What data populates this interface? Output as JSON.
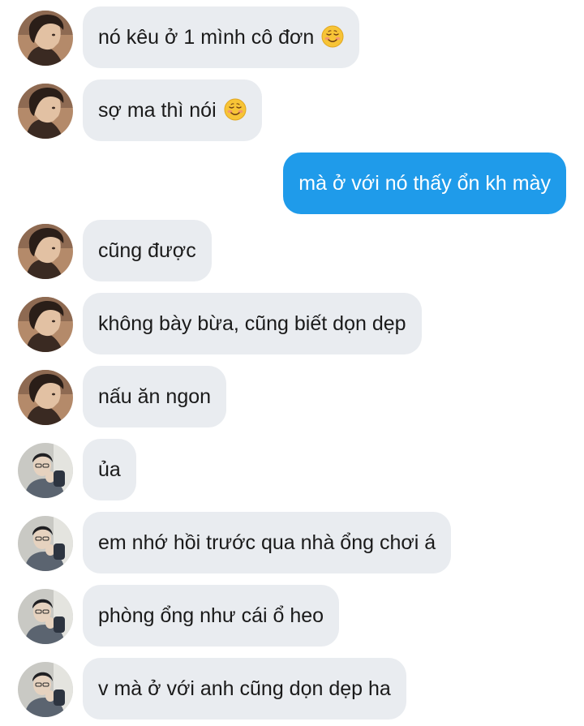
{
  "colors": {
    "incoming_bubble": "#e9ecf0",
    "outgoing_bubble": "#1f9bea",
    "text_dark": "#1a1a1a",
    "text_light": "#ffffff"
  },
  "messages": [
    {
      "side": "incoming",
      "avatar": "sender-a",
      "text": "nó kêu ở 1 mình cô đơn",
      "emoji": "smiling-face-icon"
    },
    {
      "side": "incoming",
      "avatar": "sender-a",
      "text": "sợ ma thì nói",
      "emoji": "smiling-face-icon"
    },
    {
      "side": "outgoing",
      "text": "mà ở với nó thấy ổn kh mày"
    },
    {
      "side": "incoming",
      "avatar": "sender-a",
      "text": "cũng được"
    },
    {
      "side": "incoming",
      "avatar": "sender-a",
      "text": "không bày bừa, cũng biết dọn dẹp"
    },
    {
      "side": "incoming",
      "avatar": "sender-a",
      "text": "nấu ăn ngon"
    },
    {
      "side": "incoming",
      "avatar": "sender-b",
      "text": "ủa"
    },
    {
      "side": "incoming",
      "avatar": "sender-b",
      "text": "em nhớ hồi trước qua nhà ổng chơi á"
    },
    {
      "side": "incoming",
      "avatar": "sender-b",
      "text": "phòng ổng như cái ổ heo"
    },
    {
      "side": "incoming",
      "avatar": "sender-b",
      "text": "v mà ở với anh cũng dọn dẹp ha"
    }
  ]
}
